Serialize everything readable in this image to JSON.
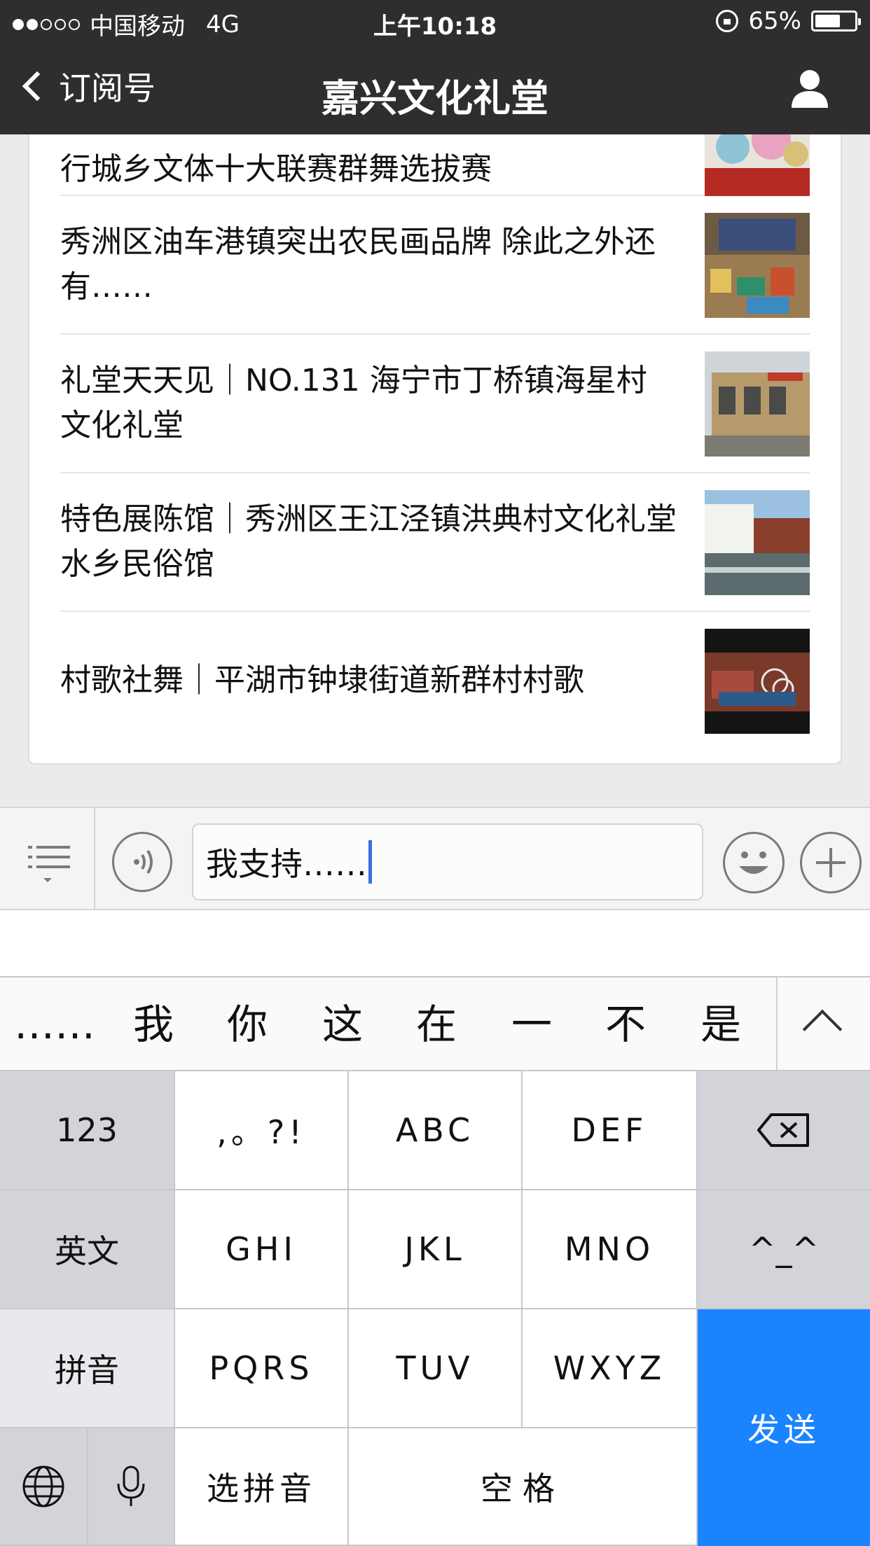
{
  "status_bar": {
    "carrier": "中国移动",
    "network": "4G",
    "time": "上午10:18",
    "battery": "65%",
    "battery_level": 0.65
  },
  "nav": {
    "back_label": "订阅号",
    "title": "嘉兴文化礼堂"
  },
  "articles": [
    {
      "title": "行城乡文体十大联赛群舞选拔赛"
    },
    {
      "title": "秀洲区油车港镇突出农民画品牌 除此之外还有……"
    },
    {
      "title": "礼堂天天见｜NO.131 海宁市丁桥镇海星村文化礼堂"
    },
    {
      "title": "特色展陈馆｜秀洲区王江泾镇洪典村文化礼堂水乡民俗馆"
    },
    {
      "title": "村歌社舞｜平湖市钟埭街道新群村村歌"
    }
  ],
  "input": {
    "value": "我支持……"
  },
  "candidates": [
    "……",
    "我",
    "你",
    "这",
    "在",
    "一",
    "不",
    "是"
  ],
  "keyboard": {
    "num": "123",
    "punct": ",。?!",
    "abc": "ABC",
    "def": "DEF",
    "en": "英文",
    "ghi": "GHI",
    "jkl": "JKL",
    "mno": "MNO",
    "emoticon": "^_^",
    "pinyin": "拼音",
    "pqrs": "PQRS",
    "tuv": "TUV",
    "wxyz": "WXYZ",
    "send": "发送",
    "select_pinyin": "选拼音",
    "space": "空格"
  },
  "colors": {
    "bar": "#2e2e30",
    "send": "#1a84ff",
    "caret": "#3b6fe0"
  }
}
